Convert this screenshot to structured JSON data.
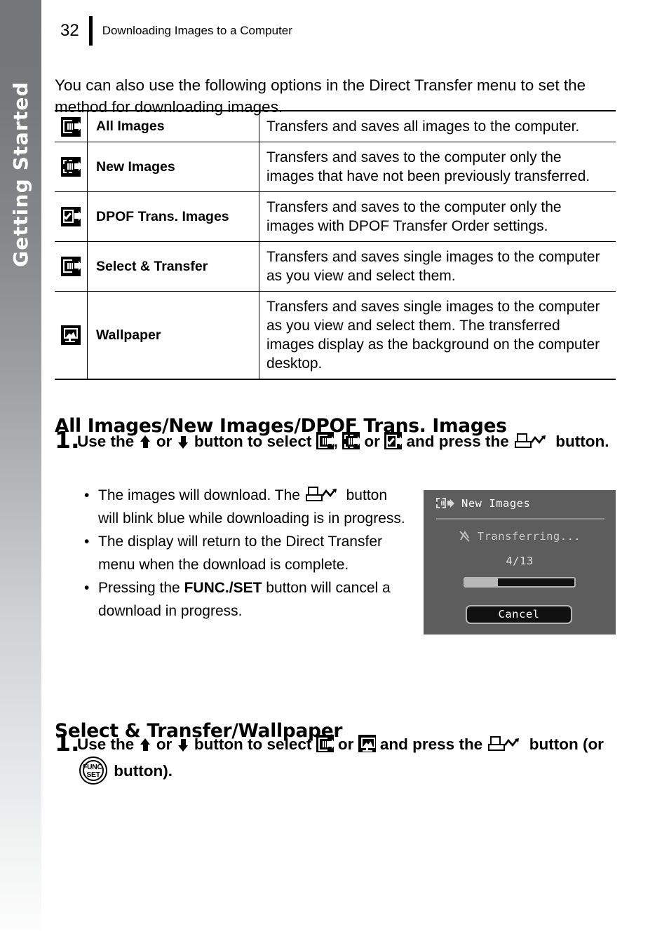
{
  "side_tab": {
    "label": "Getting Started"
  },
  "header": {
    "page_number": "32",
    "title": "Downloading Images to a Computer"
  },
  "intro": "You can also use the following options in the Direct Transfer menu to set the method for downloading images.",
  "options_table": {
    "rows": [
      {
        "icon": "transfer-all-images-icon",
        "name": "All Images",
        "description": "Transfers and saves all images to the computer."
      },
      {
        "icon": "transfer-new-images-icon",
        "name": "New Images",
        "description": "Transfers and saves to the computer only the images that have not been previously transferred."
      },
      {
        "icon": "transfer-dpof-images-icon",
        "name": "DPOF Trans. Images",
        "description": "Transfers and saves to the computer only the images with DPOF Transfer Order settings."
      },
      {
        "icon": "transfer-select-icon",
        "name": "Select & Transfer",
        "description": "Transfers and saves single images to the computer as you view and select them."
      },
      {
        "icon": "transfer-wallpaper-icon",
        "name": "Wallpaper",
        "description": "Transfers and saves single images to the computer as you view and select them. The transferred images display as the background on the computer desktop."
      }
    ]
  },
  "section_all": {
    "heading": "All Images/New Images/DPOF Trans. Images",
    "step_number": "1.",
    "step_parts": {
      "p1": "Use the",
      "p2": "or",
      "p3": "button to select",
      "p4": ",",
      "p5": "or",
      "p6": "and press the",
      "p7": "button."
    },
    "bullets": [
      {
        "before": "The images will download. The",
        "after": "button will blink blue while downloading is in progress."
      },
      {
        "text": "The display will return to the Direct Transfer menu when the download is complete."
      },
      {
        "before": "Pressing the",
        "bold": "FUNC./SET",
        "after": "button will cancel a download in progress."
      }
    ]
  },
  "lcd": {
    "title": "New Images",
    "title_icon": "new-images-transfer-icon",
    "status_icon": "transferring-icon",
    "status": "Transferring...",
    "count": "4/13",
    "progress_percent": 30,
    "cancel_label": "Cancel"
  },
  "section_select": {
    "heading": "Select & Transfer/Wallpaper",
    "step_number": "1.",
    "step_parts": {
      "p1": "Use the",
      "p2": "or",
      "p3": "button to select",
      "p4": "or",
      "p5": "and press the",
      "p6": "button (or",
      "p7": "button)."
    }
  },
  "glyphs": {
    "func_top": "FUNC.",
    "func_bottom": "SET"
  }
}
